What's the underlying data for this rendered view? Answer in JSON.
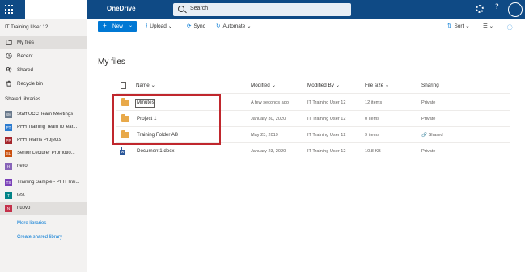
{
  "header": {
    "brand": "OneDrive",
    "search_placeholder": "Search",
    "gear_icon": "gear-icon",
    "help_label": "?"
  },
  "sidebar": {
    "user": "IT Training User 12",
    "nav": [
      {
        "label": "My files",
        "icon": "folder-icon",
        "active": true
      },
      {
        "label": "Recent",
        "icon": "clock-icon",
        "active": false
      },
      {
        "label": "Shared",
        "icon": "people-icon",
        "active": false
      },
      {
        "label": "Recycle bin",
        "icon": "trash-icon",
        "active": false
      }
    ],
    "section_title": "Shared libraries",
    "libraries": [
      {
        "label": "Staff UCC Team Meetings",
        "initials": "SM",
        "color": "#6a7a8c"
      },
      {
        "label": "PFH Training Team to lear...",
        "initials": "PT",
        "color": "#2b7bd0"
      },
      {
        "label": "PFH Teams Projects",
        "initials": "PP",
        "color": "#a4262c"
      },
      {
        "label": "Senior Lecturer Promotio...",
        "initials": "SL",
        "color": "#ca5010"
      },
      {
        "label": "hello",
        "initials": "H",
        "color": "#8764b8"
      },
      {
        "label": "Training Sample - PFH Trai...",
        "initials": "TS",
        "color": "#7a41b8"
      },
      {
        "label": "test",
        "initials": "T",
        "color": "#038387"
      },
      {
        "label": "nuovo",
        "initials": "N",
        "color": "#c4314b"
      }
    ],
    "more_libraries": "More libraries",
    "create_library": "Create shared library"
  },
  "toolbar": {
    "new_label": "New",
    "upload_label": "Upload",
    "sync_label": "Sync",
    "automate_label": "Automate",
    "sort_label": "Sort"
  },
  "main": {
    "title": "My files",
    "columns": {
      "name": "Name",
      "modified": "Modified",
      "modified_by": "Modified By",
      "file_size": "File size",
      "sharing": "Sharing"
    },
    "rows": [
      {
        "type": "folder",
        "name": "Minutes",
        "modified": "A few seconds ago",
        "modified_by": "IT Training User 12",
        "size": "12 items",
        "sharing": "Private"
      },
      {
        "type": "folder",
        "name": "Project 1",
        "modified": "January 30, 2020",
        "modified_by": "IT Training User 12",
        "size": "0 items",
        "sharing": "Private"
      },
      {
        "type": "folder",
        "name": "Training Folder AB",
        "modified": "May 23, 2019",
        "modified_by": "IT Training User 12",
        "size": "9 items",
        "sharing": "Shared"
      },
      {
        "type": "docx",
        "name": "Document1.docx",
        "modified": "January 23, 2020",
        "modified_by": "IT Training User 12",
        "size": "10.8 KB",
        "sharing": "Private"
      }
    ]
  },
  "colors": {
    "header_bg": "#0f4a85",
    "accent": "#0078d4",
    "highlight": "#c0272d"
  }
}
